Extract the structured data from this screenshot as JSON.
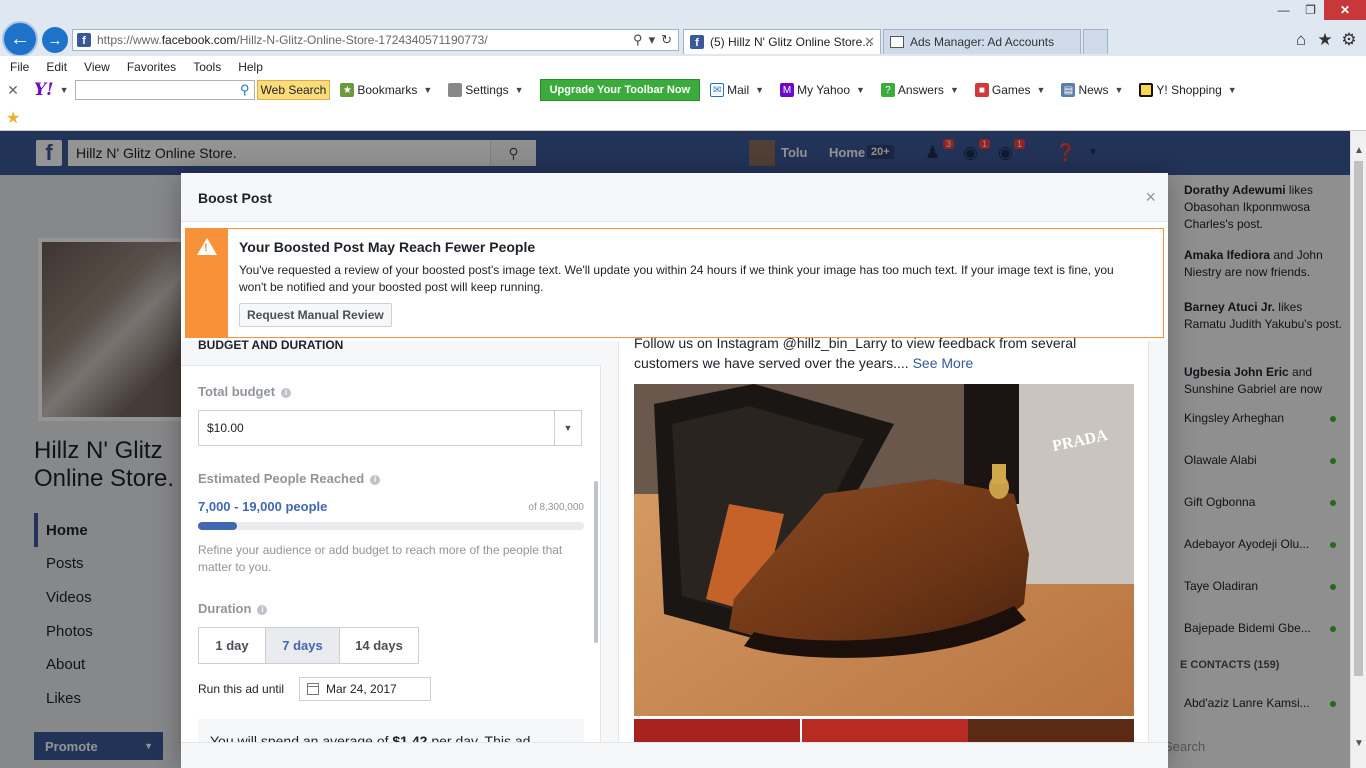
{
  "browser": {
    "url_prefix": "https://www.",
    "url_domain": "facebook.com",
    "url_path": "/Hillz-N-Glitz-Online-Store-1724340571190773/",
    "tabs": [
      {
        "label": "(5) Hillz N' Glitz Online Store...",
        "active": true
      },
      {
        "label": "Ads Manager: Ad Accounts",
        "active": false
      }
    ],
    "menu": [
      "File",
      "Edit",
      "View",
      "Favorites",
      "Tools",
      "Help"
    ]
  },
  "yahoo_toolbar": {
    "logo": "Y!",
    "web_search": "Web Search",
    "bookmarks": "Bookmarks",
    "settings": "Settings",
    "upgrade": "Upgrade Your Toolbar Now",
    "mail": "Mail",
    "my_yahoo": "My Yahoo",
    "answers": "Answers",
    "games": "Games",
    "news": "News",
    "shopping": "Y! Shopping"
  },
  "facebook": {
    "search_value": "Hillz N' Glitz Online Store.",
    "user_name": "Tolu",
    "home_label": "Home",
    "home_count": "20+",
    "badges": {
      "friends": "3",
      "messages": "1",
      "notifications": "1"
    },
    "page_name": "Hillz N' Glitz Online Store.",
    "left_nav": [
      "Home",
      "Posts",
      "Videos",
      "Photos",
      "About",
      "Likes"
    ],
    "promote": "Promote",
    "ticker": [
      {
        "name": "Dorathy Adewumi",
        "text": " likes Obasohan Ikponmwosa Charles's post."
      },
      {
        "name": "Amaka Ifediora",
        "text": " and John Niestry are now friends."
      },
      {
        "name": "Barney Atuci Jr.",
        "text": " likes Ramatu Judith Yakubu's post."
      },
      {
        "name": "Ugbesia John Eric",
        "text": " and Sunshine Gabriel are now"
      }
    ],
    "contacts": [
      "Kingsley Arheghan",
      "Olawale Alabi",
      "Gift Ogbonna",
      "Adebayor Ayodeji Olu...",
      "Taye Oladiran",
      "Bajepade Bidemi Gbe..."
    ],
    "contacts_header": "E CONTACTS (159)",
    "contact_last": "Abd'aziz Lanre Kamsi...",
    "chat_search": "Search"
  },
  "dialog": {
    "title": "Boost Post",
    "warning_title": "Your Boosted Post May Reach Fewer People",
    "warning_body": "You've requested a review of your boosted post's image text. We'll update you within 24 hours if we think your image has too much text. If your image text is fine, you won't be notified and your boosted post will keep running.",
    "warning_button": "Request Manual Review",
    "section_heading": "BUDGET AND DURATION",
    "total_budget_label": "Total budget",
    "budget_value": "$10.00",
    "reach_label": "Estimated People Reached",
    "reach_range": "7,000 - 19,000 people",
    "reach_total": "of 8,300,000",
    "reach_fraction": 0.1,
    "reach_note": "Refine your audience or add budget to reach more of the people that matter to you.",
    "duration_label": "Duration",
    "durations": [
      "1 day",
      "7 days",
      "14 days"
    ],
    "selected_duration": "7 days",
    "run_until_label": "Run this ad until",
    "run_until_date": "Mar 24, 2017",
    "spend_prefix": "You will spend an average of ",
    "spend_amount": "$1.42",
    "spend_suffix": " per day. This ad",
    "post_text": "Follow us on Instagram @hillz_bin_Larry to view feedback from several customers we have served over the years.... ",
    "see_more": "See More",
    "shoe_label": "PRADA"
  },
  "colors": {
    "fb_blue": "#3b5998",
    "warning_orange": "#f7923a",
    "link_blue": "#4267b2"
  }
}
